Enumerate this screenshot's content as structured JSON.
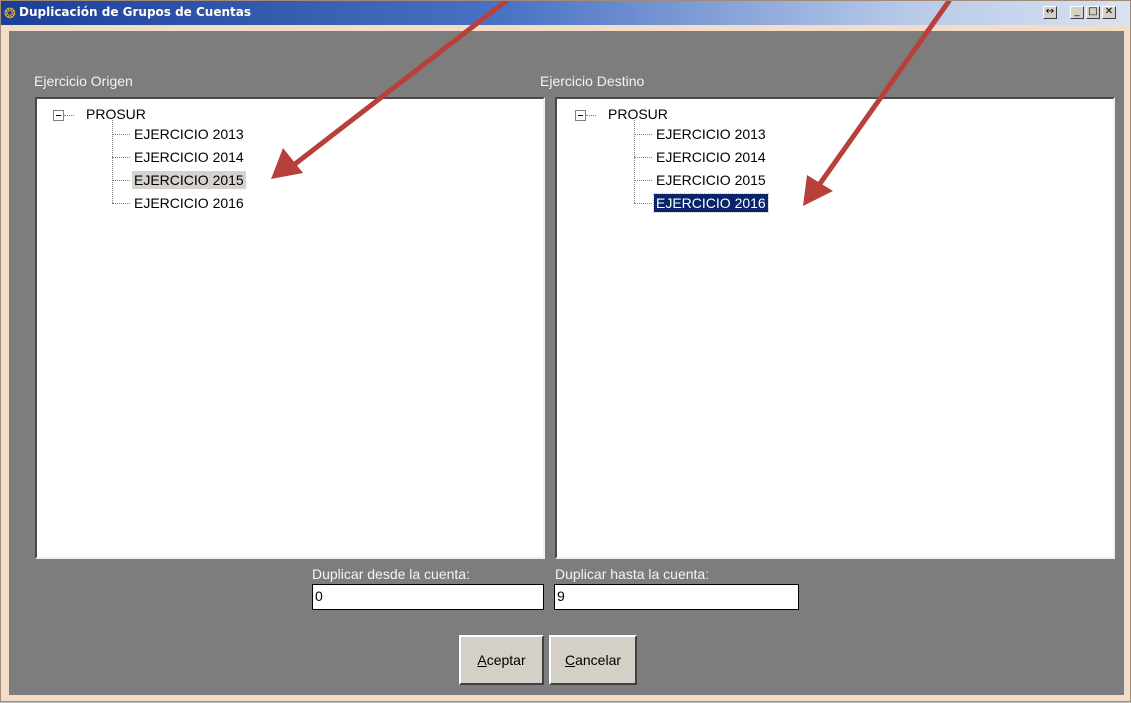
{
  "window": {
    "title": "Duplicación de Grupos de Cuentas",
    "app_icon": "coins-icon",
    "buttons": [
      "resize-icon",
      "minimize-icon",
      "maximize-icon",
      "close-icon"
    ]
  },
  "origin": {
    "label": "Ejercicio Origen",
    "root": "PROSUR",
    "items": [
      "EJERCICIO 2013",
      "EJERCICIO 2014",
      "EJERCICIO 2015",
      "EJERCICIO 2016"
    ],
    "selected": "EJERCICIO 2015"
  },
  "destination": {
    "label": "Ejercicio Destino",
    "root": "PROSUR",
    "items": [
      "EJERCICIO 2013",
      "EJERCICIO 2014",
      "EJERCICIO 2015",
      "EJERCICIO 2016"
    ],
    "selected": "EJERCICIO 2016"
  },
  "from_account": {
    "label": "Duplicar desde la cuenta:",
    "value": "0"
  },
  "to_account": {
    "label": "Duplicar hasta la cuenta:",
    "value": "9"
  },
  "buttons": {
    "accept": {
      "mnemonic": "A",
      "rest": "ceptar"
    },
    "cancel": {
      "mnemonic": "C",
      "rest": "ancelar"
    }
  },
  "colors": {
    "arrow": "#b8403a",
    "client_bg": "#7d7d7d",
    "selection_blue": "#0a246a"
  }
}
